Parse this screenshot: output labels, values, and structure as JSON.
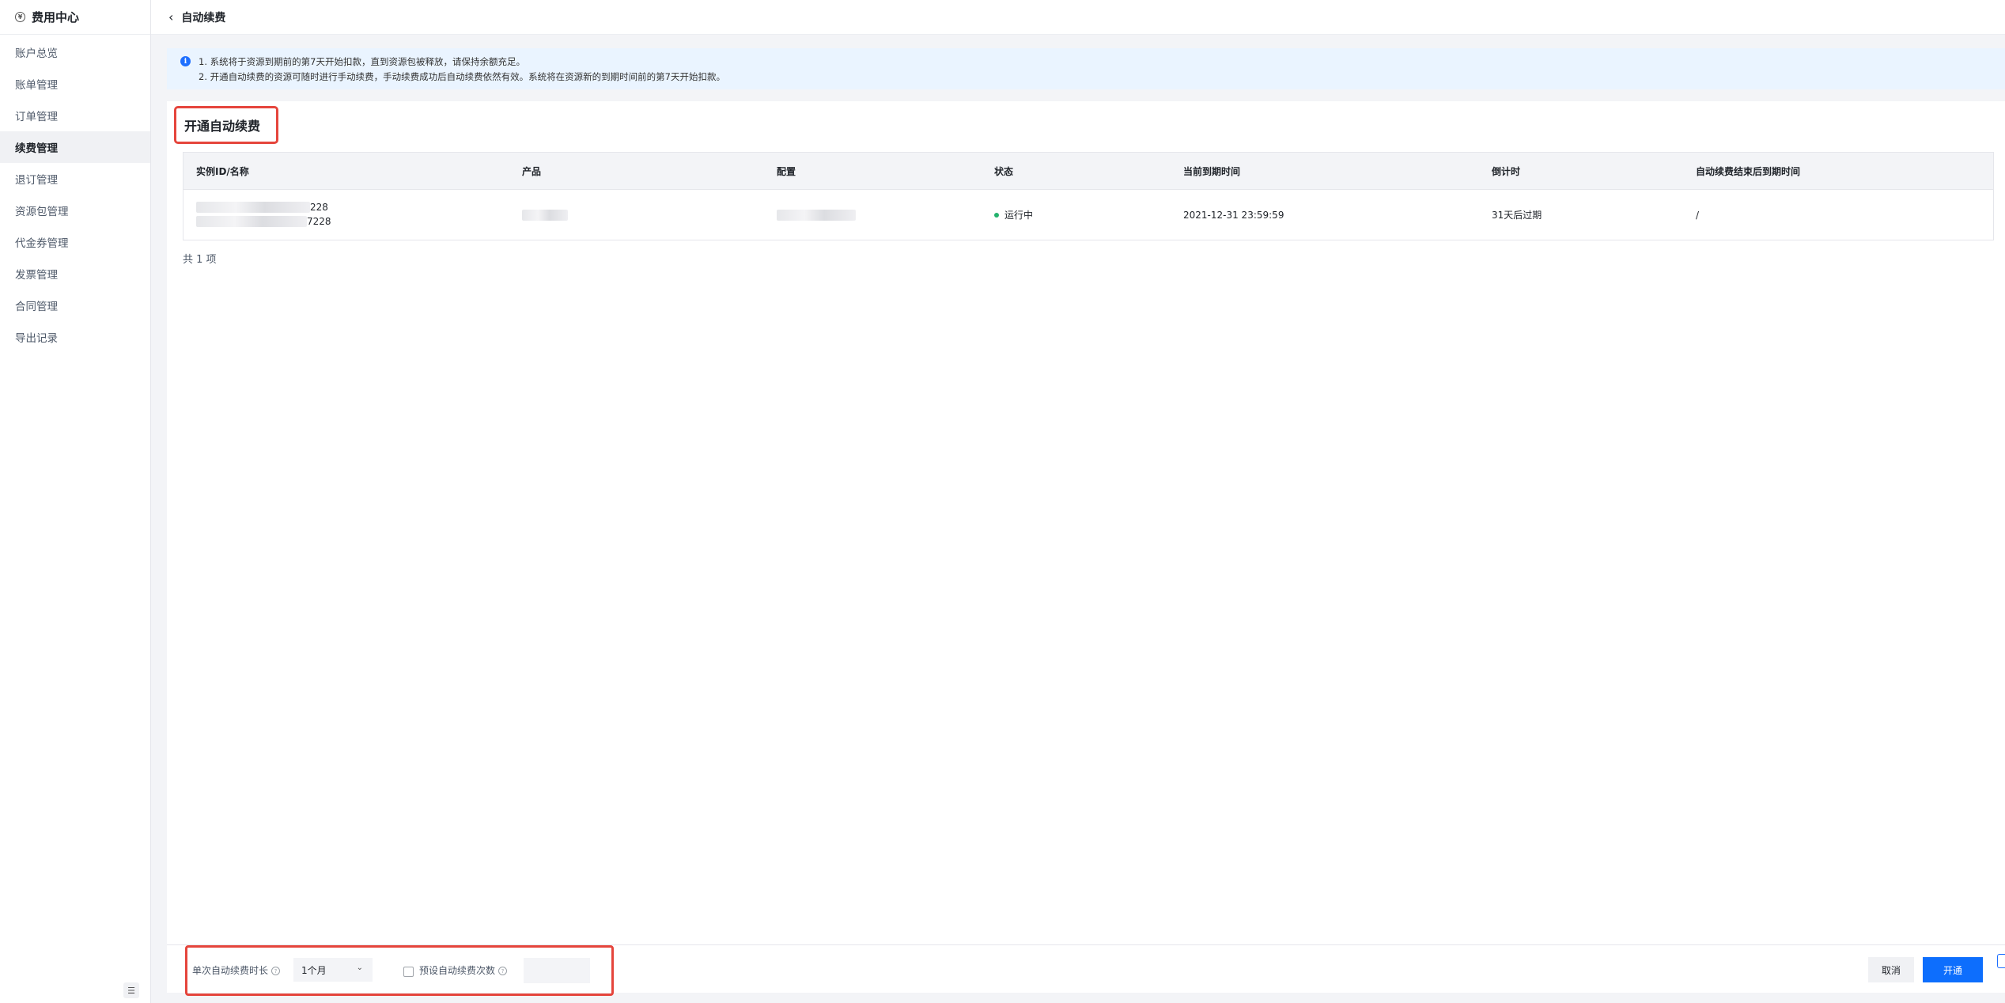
{
  "sidebar": {
    "title": "费用中心",
    "items": [
      {
        "label": "账户总览"
      },
      {
        "label": "账单管理"
      },
      {
        "label": "订单管理"
      },
      {
        "label": "续费管理"
      },
      {
        "label": "退订管理"
      },
      {
        "label": "资源包管理"
      },
      {
        "label": "代金券管理"
      },
      {
        "label": "发票管理"
      },
      {
        "label": "合同管理"
      },
      {
        "label": "导出记录"
      }
    ],
    "active_index": 3
  },
  "header": {
    "title": "自动续费"
  },
  "notice": {
    "line1": "1. 系统将于资源到期前的第7天开始扣款，直到资源包被释放，请保持余额充足。",
    "line2": "2. 开通自动续费的资源可随时进行手动续费，手动续费成功后自动续费依然有效。系统将在资源新的到期时间前的第7天开始扣款。"
  },
  "section": {
    "title": "开通自动续费"
  },
  "table": {
    "headers": [
      "实例ID/名称",
      "产品",
      "配置",
      "状态",
      "当前到期时间",
      "倒计时",
      "自动续费结束后到期时间"
    ],
    "rows": [
      {
        "id_suffix": "228",
        "name_suffix": "7228",
        "status": "运行中",
        "expire_time": "2021-12-31 23:59:59",
        "countdown": "31天后过期",
        "auto_end_time": "/"
      }
    ],
    "total_text": "共 1 项"
  },
  "footer": {
    "duration_label": "单次自动续费时长",
    "duration_value": "1个月",
    "preset_label": "预设自动续费次数",
    "cancel_label": "取消",
    "submit_label": "开通"
  },
  "colors": {
    "accent": "#0d6efd",
    "highlight_border": "#e5453c",
    "status_running": "#23b26d"
  }
}
